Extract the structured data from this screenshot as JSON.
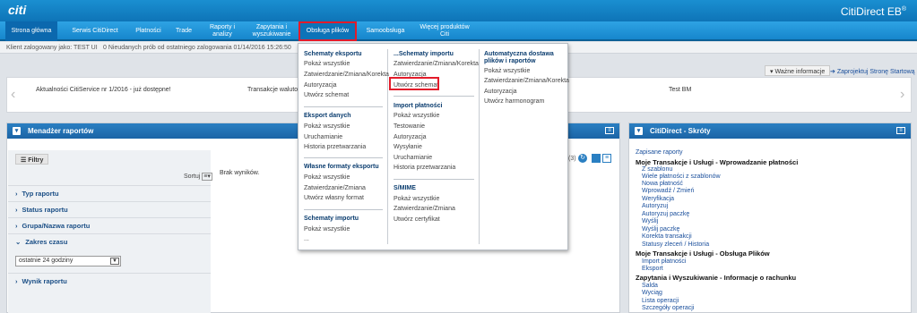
{
  "header": {
    "logo": "citi",
    "product": "CitiDirect EB",
    "product_sup": "®"
  },
  "nav": {
    "items": [
      {
        "label": "Strona główna"
      },
      {
        "label": "Serwis CitiDirect"
      },
      {
        "label": "Płatności"
      },
      {
        "label": "Trade"
      },
      {
        "label": "Raporty i analizy"
      },
      {
        "label": "Zapytania i wyszukiwanie"
      },
      {
        "label": "Obsługa plików"
      },
      {
        "label": "Samoobsługa"
      },
      {
        "label": "Więcej produktów Citi"
      }
    ]
  },
  "status": {
    "user_label": "Klient zalogowany jako: TEST UI",
    "login_info": "0 Nieudanych prób od ostatniego zalogowania 01/14/2016 15:26:50"
  },
  "infobar": {
    "important_btn": "Ważne informacje",
    "start_page_link": "Zaprojektuj Stronę Startową",
    "messages": [
      "Aktualności CitiService nr 1/2016 - już dostępne!",
      "Transakcje walutowe",
      "Test BM"
    ]
  },
  "report_manager": {
    "title": "Menadżer raportów",
    "filters_btn": "Filtry",
    "sort_label": "Sortuj",
    "no_results": "Brak wyników.",
    "pager_fragment": "(3)",
    "filters": [
      {
        "label": "Typ raportu",
        "expanded": false
      },
      {
        "label": "Status raportu",
        "expanded": false
      },
      {
        "label": "Grupa/Nazwa raportu",
        "expanded": false
      },
      {
        "label": "Zakres czasu",
        "expanded": true
      },
      {
        "label": "Wynik raportu",
        "expanded": false
      }
    ],
    "time_range_value": "ostatnie 24 godziny"
  },
  "shortcuts": {
    "title": "CitiDirect - Skróty",
    "saved_reports": "Zapisane raporty",
    "sections": [
      {
        "title": "Moje Transakcje i Usługi - Wprowadzanie płatności",
        "links": [
          "Z szablonu",
          "Wiele płatności z szablonów",
          "Nowa płatność",
          "Wprowadź / Zmień",
          "Weryfikacja",
          "Autoryzuj",
          "Autoryzuj paczkę",
          "Wyślij",
          "Wyślij paczkę",
          "Korekta transakcji",
          "Statusy zleceń / Historia"
        ]
      },
      {
        "title": "Moje Transakcje i Usługi - Obsługa Plików",
        "links": [
          "Import płatności",
          "Eksport"
        ]
      },
      {
        "title": "Zapytania i Wyszukiwanie - Informacje o rachunku",
        "links": [
          "Salda",
          "Wyciąg",
          "Lista operacji",
          "Szczegóły operacji"
        ]
      }
    ]
  },
  "menu": {
    "col1": [
      {
        "title": "Schematy eksportu",
        "items": [
          "Pokaż wszystkie",
          "Zatwierdzanie/Zmiana/Korekta",
          "Autoryzacja",
          "Utwórz schemat"
        ]
      },
      {
        "title": "Eksport danych",
        "items": [
          "Pokaż wszystkie",
          "Uruchamianie",
          "Historia przetwarzania"
        ]
      },
      {
        "title": "Własne formaty eksportu",
        "items": [
          "Pokaż wszystkie",
          "Zatwierdzanie/Zmiana",
          "Utwórz własny format"
        ]
      },
      {
        "title": "Schematy importu",
        "items": [
          "Pokaż wszystkie",
          "..."
        ]
      }
    ],
    "col2": [
      {
        "title": "...Schematy importu",
        "items": [
          "Zatwierdzanie/Zmiana/Korekta",
          "Autoryzacja",
          "Utwórz schemat"
        ]
      },
      {
        "title": "Import płatności",
        "items": [
          "Pokaż wszystkie",
          "Testowanie",
          "Autoryzacja",
          "Wysyłanie",
          "Uruchamianie",
          "Historia przetwarzania"
        ]
      },
      {
        "title": "S/MIME",
        "items": [
          "Pokaż wszystkie",
          "Zatwierdzanie/Zmiana",
          "Utwórz certyfikat"
        ]
      }
    ],
    "col3": [
      {
        "title": "Automatyczna dostawa plików i raportów",
        "items": [
          "Pokaż wszystkie",
          "Zatwierdzanie/Zmiana/Korekta",
          "Autoryzacja",
          "Utwórz harmonogram"
        ]
      }
    ]
  },
  "colors": {
    "nav_blue": "#1686cc",
    "panel_blue": "#1b64a6",
    "highlight_red": "#e31b2a"
  }
}
